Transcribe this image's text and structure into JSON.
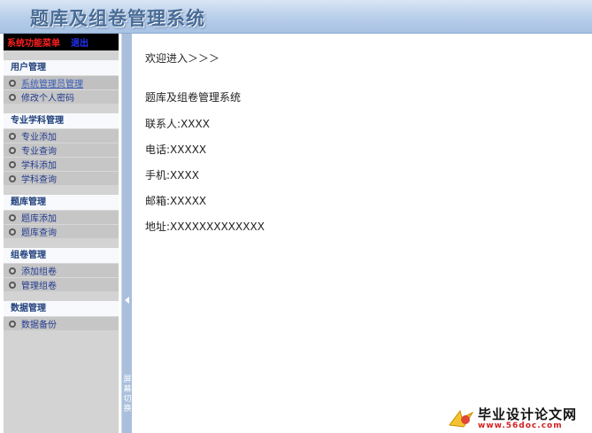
{
  "header": {
    "title": "题库及组卷管理系统"
  },
  "sidebar": {
    "menu_label": "系统功能菜单",
    "logout_label": "退出",
    "groups": [
      {
        "title": "用户管理",
        "items": [
          {
            "label": "系统管理员管理"
          },
          {
            "label": "修改个人密码"
          }
        ]
      },
      {
        "title": "专业学科管理",
        "items": [
          {
            "label": "专业添加"
          },
          {
            "label": "专业查询"
          },
          {
            "label": "学科添加"
          },
          {
            "label": "学科查询"
          }
        ]
      },
      {
        "title": "题库管理",
        "items": [
          {
            "label": "题库添加"
          },
          {
            "label": "题库查询"
          }
        ]
      },
      {
        "title": "组卷管理",
        "items": [
          {
            "label": "添加组卷"
          },
          {
            "label": "管理组卷"
          }
        ]
      },
      {
        "title": "数据管理",
        "items": [
          {
            "label": "数据备份"
          }
        ]
      }
    ]
  },
  "splitter": {
    "label": "屏幕切换"
  },
  "main": {
    "welcome": "欢迎进入＞＞＞",
    "system_name": "题库及组卷管理系统",
    "contact": "联系人:XXXX",
    "phone": "电话:XXXXX",
    "mobile": "手机:XXXX",
    "email": "邮箱:XXXXX",
    "address": "地址:XXXXXXXXXXXXX"
  },
  "watermark": {
    "title": "毕业设计论文网",
    "url": "www.56doc.com"
  },
  "colors": {
    "header_bg": "#b7cde9",
    "sidebar_bg": "#d3d3d3",
    "accent_red": "#ff2020",
    "link_blue": "#233a8c"
  }
}
